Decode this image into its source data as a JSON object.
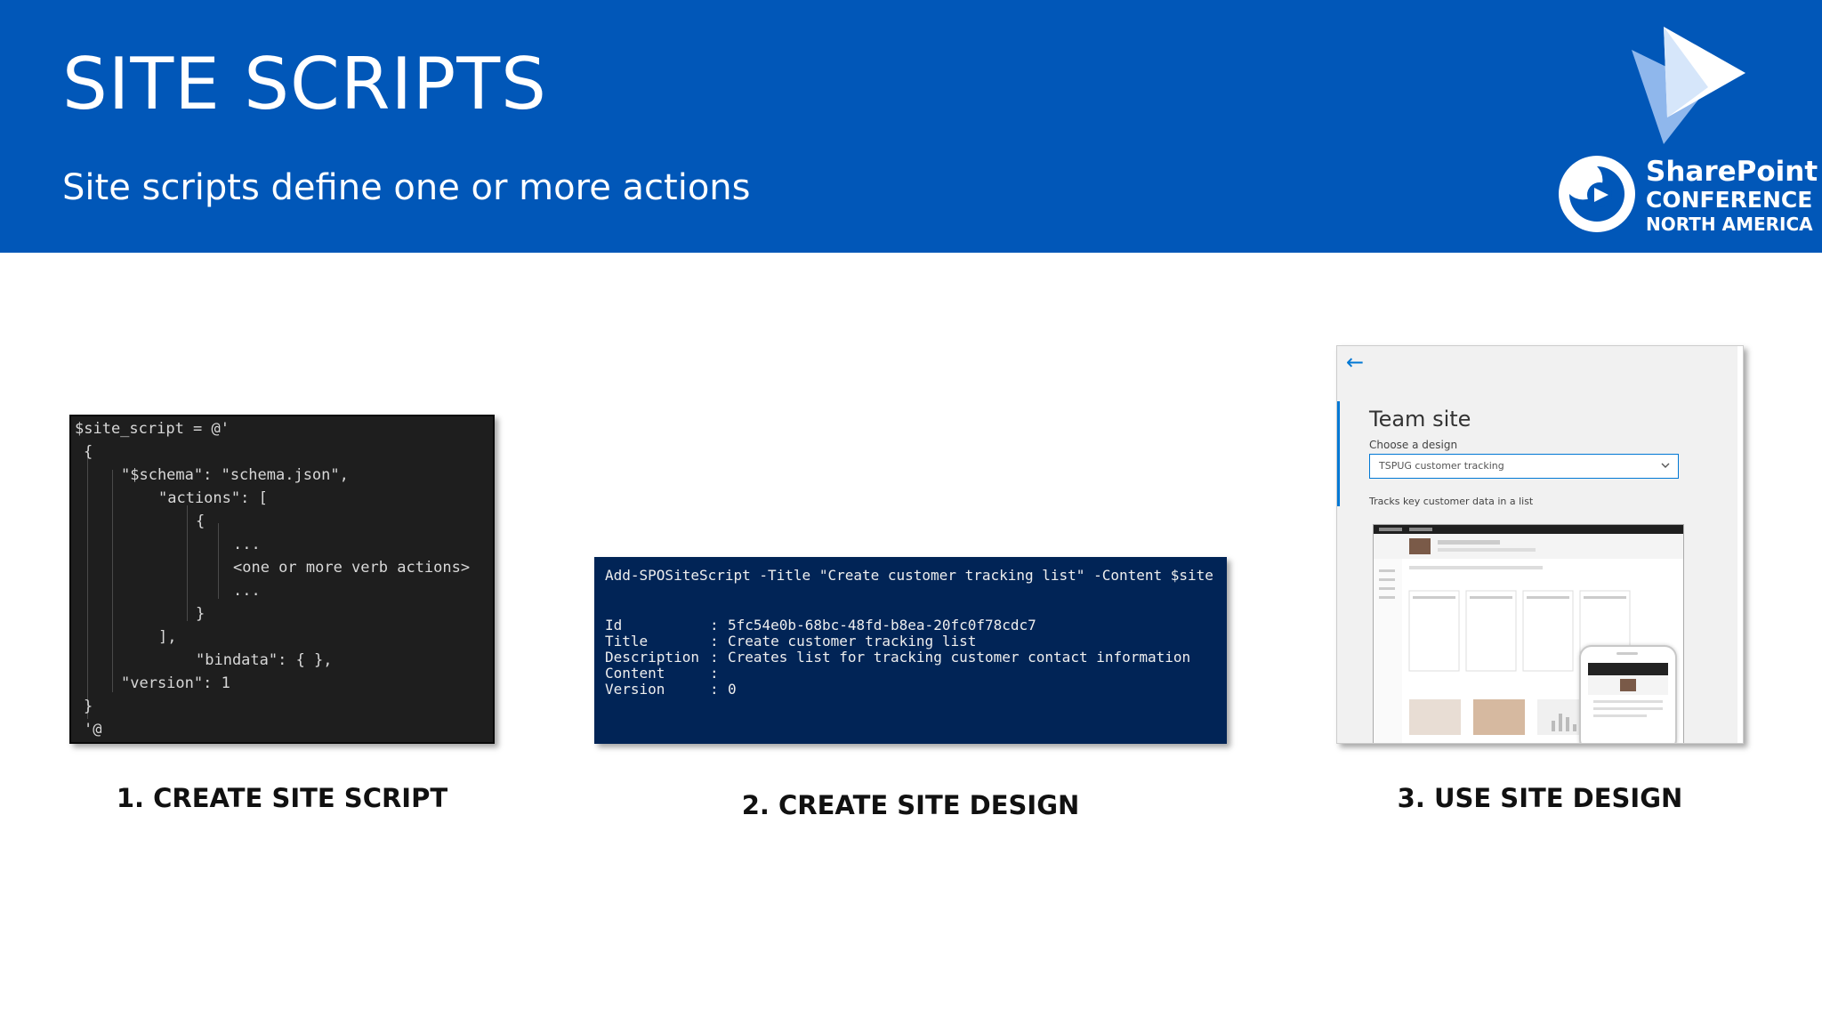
{
  "slide": {
    "title": "SITE SCRIPTS",
    "subtitle": "Site scripts define one or more actions"
  },
  "logo": {
    "line1": "SharePoint",
    "line2": "CONFERENCE",
    "line3": "NORTH AMERICA"
  },
  "steps": [
    {
      "caption": "1. CREATE SITE SCRIPT"
    },
    {
      "caption": "2. CREATE SITE DESIGN"
    },
    {
      "caption": "3. USE SITE DESIGN"
    }
  ],
  "code_editor": {
    "lines": [
      "$site_script = @'",
      "{",
      "\"$schema\": \"schema.json\",",
      "\"actions\": [",
      "{",
      "...",
      "<one or more verb actions>",
      "...",
      "}",
      "],",
      "\"bindata\": { },",
      "\"version\": 1",
      "}",
      "'@"
    ]
  },
  "powershell": {
    "command": "Add-SPOSiteScript -Title \"Create customer tracking list\" -Content $site",
    "output": [
      {
        "key": "Id",
        "value": "5fc54e0b-68bc-48fd-b8ea-20fc0f78cdc7"
      },
      {
        "key": "Title",
        "value": "Create customer tracking list"
      },
      {
        "key": "Description",
        "value": "Creates list for tracking customer contact information"
      },
      {
        "key": "Content",
        "value": ""
      },
      {
        "key": "Version",
        "value": "0"
      }
    ]
  },
  "team_site": {
    "title": "Team site",
    "choose_label": "Choose a design",
    "selected_design": "TSPUG customer tracking",
    "description": "Tracks key customer data in a list"
  },
  "colors": {
    "banner": "#0157b8",
    "powershell_bg": "#012456",
    "editor_bg": "#1e1e1e",
    "accent": "#0078d4"
  }
}
